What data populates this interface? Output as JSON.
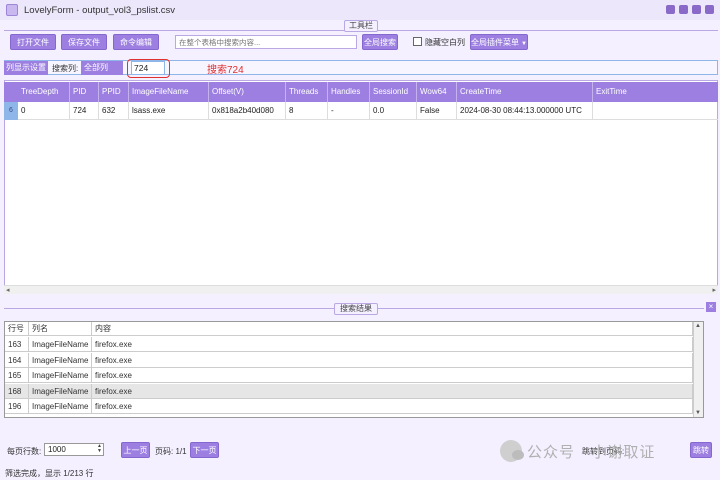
{
  "window": {
    "title": "LovelyForm - output_vol3_pslist.csv"
  },
  "toolbar": {
    "caption": "工具栏",
    "open_file": "打开文件",
    "save_file": "保存文件",
    "command_edit": "命令编辑",
    "global_search_placeholder": "在整个表格中搜索内容...",
    "global_search_button": "全局搜索",
    "hide_empty_columns": "隐藏空白列",
    "plugin_menu": "全局插件菜单"
  },
  "search_bar": {
    "column_settings": "列显示设置",
    "search_column_label": "搜索列:",
    "search_column_value": "全部列",
    "search_value": "724",
    "annotation": "搜索724"
  },
  "main_table": {
    "headers": [
      "TreeDepth",
      "PID",
      "PPID",
      "ImageFileName",
      "Offset(V)",
      "Threads",
      "Handles",
      "SessionId",
      "Wow64",
      "CreateTime",
      "ExitTime"
    ],
    "row_marker": "6",
    "rows": [
      [
        "0",
        "724",
        "632",
        "lsass.exe",
        "0x818a2b40d080",
        "8",
        "-",
        "0.0",
        "False",
        "2024-08-30 08:44:13.000000 UTC",
        ""
      ]
    ]
  },
  "search_results": {
    "caption": "搜索结果",
    "close": "×",
    "headers": [
      "行号",
      "列名",
      "内容"
    ],
    "rows": [
      [
        "163",
        "ImageFileName",
        "firefox.exe"
      ],
      [
        "164",
        "ImageFileName",
        "firefox.exe"
      ],
      [
        "165",
        "ImageFileName",
        "firefox.exe"
      ],
      [
        "168",
        "ImageFileName",
        "firefox.exe"
      ],
      [
        "196",
        "ImageFileName",
        "firefox.exe"
      ]
    ],
    "selected_row": 3
  },
  "pagination": {
    "rows_per_page_label": "每页行数:",
    "rows_per_page_value": "1000",
    "prev": "上一页",
    "page_info": "页码: 1/1",
    "next": "下一页",
    "jump_label": "跳转到页码:",
    "jump_button": "跳转"
  },
  "status": "筛选完成，显示 1/213 行",
  "watermark": "公众号 · 小谢取证",
  "colors": {
    "accent": "#9c7fe0",
    "background": "#f4f0ff",
    "highlight_red": "#e03030",
    "row_marker": "#8fb6e8"
  }
}
